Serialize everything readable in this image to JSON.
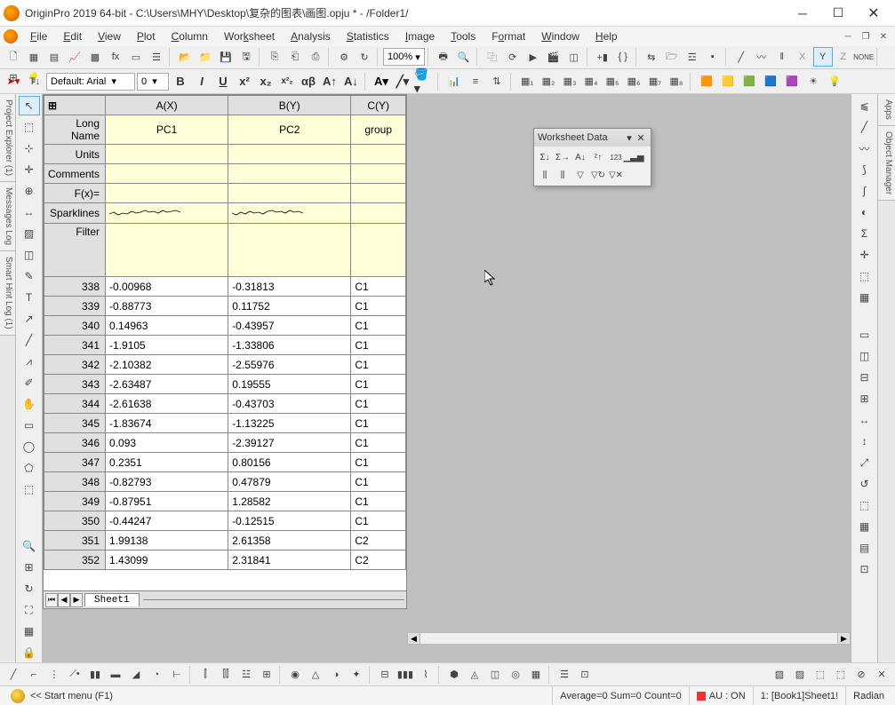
{
  "title": "OriginPro 2019 64-bit - C:\\Users\\MHY\\Desktop\\复杂的图表\\画图.opju * - /Folder1/",
  "menus": [
    "File",
    "Edit",
    "View",
    "Plot",
    "Column",
    "Worksheet",
    "Analysis",
    "Statistics",
    "Image",
    "Tools",
    "Format",
    "Window",
    "Help"
  ],
  "zoom": "100%",
  "font": "Default: Arial",
  "fontsize": "0",
  "left_dock_tabs": [
    "Project Explorer (1)",
    "Messages Log",
    "Smart Hint Log (1)"
  ],
  "right_dock_tabs": [
    "Apps",
    "Object Manager"
  ],
  "floating": {
    "title": "Worksheet Data"
  },
  "columns": [
    "A(X)",
    "B(Y)",
    "C(Y)"
  ],
  "meta_rows": [
    "Long Name",
    "Units",
    "Comments",
    "F(x)=",
    "Sparklines",
    "Filter"
  ],
  "long_names": [
    "PC1",
    "PC2",
    "group"
  ],
  "sheets": [
    "Sheet1"
  ],
  "data": [
    {
      "idx": 338,
      "a": "-0.00968",
      "b": "-0.31813",
      "c": "C1"
    },
    {
      "idx": 339,
      "a": "-0.88773",
      "b": "0.11752",
      "c": "C1"
    },
    {
      "idx": 340,
      "a": "0.14963",
      "b": "-0.43957",
      "c": "C1"
    },
    {
      "idx": 341,
      "a": "-1.9105",
      "b": "-1.33806",
      "c": "C1"
    },
    {
      "idx": 342,
      "a": "-2.10382",
      "b": "-2.55976",
      "c": "C1"
    },
    {
      "idx": 343,
      "a": "-2.63487",
      "b": "0.19555",
      "c": "C1"
    },
    {
      "idx": 344,
      "a": "-2.61638",
      "b": "-0.43703",
      "c": "C1"
    },
    {
      "idx": 345,
      "a": "-1.83674",
      "b": "-1.13225",
      "c": "C1"
    },
    {
      "idx": 346,
      "a": "0.093",
      "b": "-2.39127",
      "c": "C1"
    },
    {
      "idx": 347,
      "a": "0.2351",
      "b": "0.80156",
      "c": "C1"
    },
    {
      "idx": 348,
      "a": "-0.82793",
      "b": "0.47879",
      "c": "C1"
    },
    {
      "idx": 349,
      "a": "-0.87951",
      "b": "1.28582",
      "c": "C1"
    },
    {
      "idx": 350,
      "a": "-0.44247",
      "b": "-0.12515",
      "c": "C1"
    },
    {
      "idx": 351,
      "a": "1.99138",
      "b": "2.61358",
      "c": "C2"
    },
    {
      "idx": 352,
      "a": "1.43099",
      "b": "2.31841",
      "c": "C2"
    }
  ],
  "status": {
    "hint": "<< Start menu (F1)",
    "stats": "Average=0 Sum=0 Count=0",
    "au": "AU : ON",
    "loc": "1: [Book1]Sheet1!",
    "angle": "Radian"
  }
}
